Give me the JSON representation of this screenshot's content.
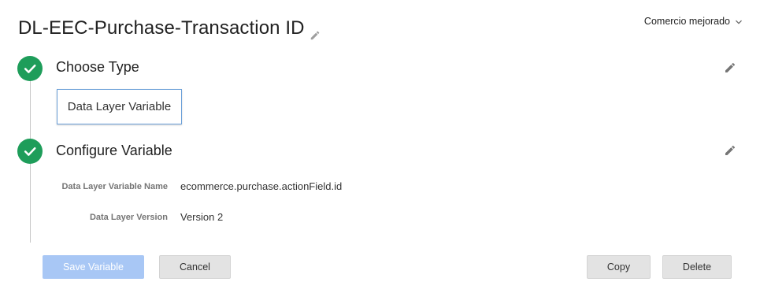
{
  "header": {
    "title": "DL-EEC-Purchase-Transaction ID",
    "workspace_label": "Comercio mejorado"
  },
  "steps": [
    {
      "title": "Choose Type",
      "status": "complete",
      "selected_type": "Data Layer Variable"
    },
    {
      "title": "Configure Variable",
      "status": "complete",
      "fields": [
        {
          "label": "Data Layer Variable Name",
          "value": "ecommerce.purchase.actionField.id"
        },
        {
          "label": "Data Layer Version",
          "value": "Version 2"
        }
      ]
    }
  ],
  "actions": {
    "save_label": "Save Variable",
    "cancel_label": "Cancel",
    "copy_label": "Copy",
    "delete_label": "Delete"
  },
  "colors": {
    "check_green": "#1e9d5a",
    "save_disabled_blue": "#a8c7f5",
    "chip_border": "#6a9fd8",
    "secondary_button": "#e3e3e3"
  },
  "icons": {
    "title_edit": "pencil-icon",
    "workspace_dropdown": "chevron-down-icon",
    "step_status": "check-icon",
    "step_edit": "pencil-icon"
  }
}
